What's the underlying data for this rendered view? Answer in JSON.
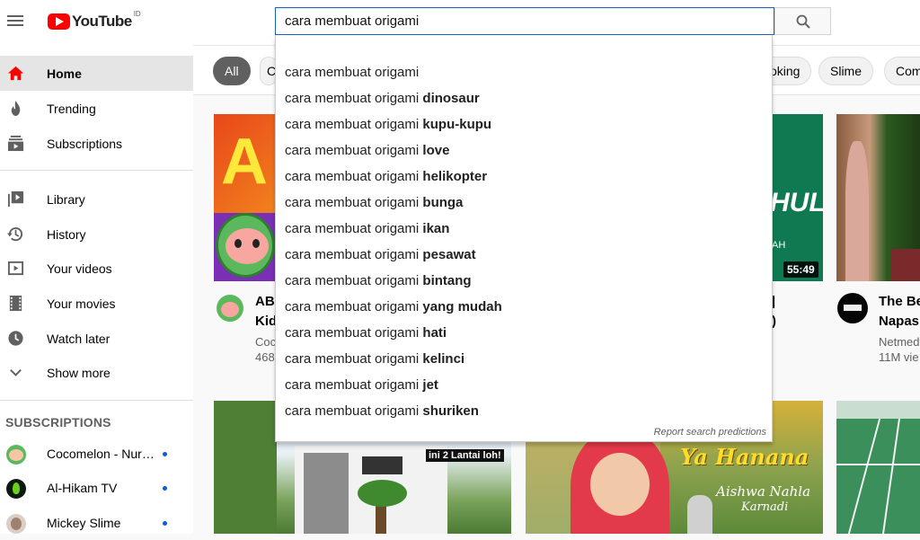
{
  "header": {
    "logo_text": "YouTube",
    "region": "ID",
    "search_value": "cara membuat origami"
  },
  "sidebar": {
    "items": [
      {
        "label": "Home",
        "icon": "home-icon"
      },
      {
        "label": "Trending",
        "icon": "trending-icon"
      },
      {
        "label": "Subscriptions",
        "icon": "subscriptions-icon"
      },
      {
        "label": "Library",
        "icon": "library-icon"
      },
      {
        "label": "History",
        "icon": "history-icon"
      },
      {
        "label": "Your videos",
        "icon": "your-videos-icon"
      },
      {
        "label": "Your movies",
        "icon": "your-movies-icon"
      },
      {
        "label": "Watch later",
        "icon": "watch-later-icon"
      },
      {
        "label": "Show more",
        "icon": "chevron-down-icon"
      }
    ],
    "subscriptions_heading": "SUBSCRIPTIONS",
    "subscriptions": [
      {
        "label": "Cocomelon - Nurs..."
      },
      {
        "label": "Al-Hikam TV"
      },
      {
        "label": "Mickey Slime"
      }
    ]
  },
  "chips": [
    {
      "label": "All"
    },
    {
      "label": "C"
    },
    {
      "label": "oking"
    },
    {
      "label": "Slime"
    },
    {
      "label": "Com"
    }
  ],
  "suggestions": {
    "prefix": "cara membuat origami",
    "items": [
      {
        "suffix": ""
      },
      {
        "suffix": "dinosaur"
      },
      {
        "suffix": "kupu-kupu"
      },
      {
        "suffix": "love"
      },
      {
        "suffix": "helikopter"
      },
      {
        "suffix": "bunga"
      },
      {
        "suffix": "ikan"
      },
      {
        "suffix": "pesawat"
      },
      {
        "suffix": "bintang"
      },
      {
        "suffix": "yang mudah"
      },
      {
        "suffix": "hati"
      },
      {
        "suffix": "kelinci"
      },
      {
        "suffix": "jet"
      },
      {
        "suffix": "shuriken"
      }
    ],
    "report": "Report search predictions"
  },
  "videos": {
    "v1": {
      "title1": "AB",
      "title2": "Kid",
      "channel": "Coc",
      "views": "468"
    },
    "v3": {
      "title1": "|",
      "title2": ")",
      "duration": "55:49",
      "thumb_text1": "HUL",
      "thumb_text2": "AH"
    },
    "v4": {
      "title1": "The Be",
      "title2": "Napas",
      "channel": "Netmed",
      "views": "11M vie"
    },
    "v5": {
      "overlay": "ini 2 Lantai loh!"
    },
    "v7": {
      "overlay1": "Ya Hanana",
      "overlay2": "Aishwa Nahla",
      "overlay3": "Karnadi"
    }
  },
  "colors": {
    "brand_red": "#ff0000",
    "link_blue": "#065fd4",
    "focus_border": "#1c62b9"
  }
}
